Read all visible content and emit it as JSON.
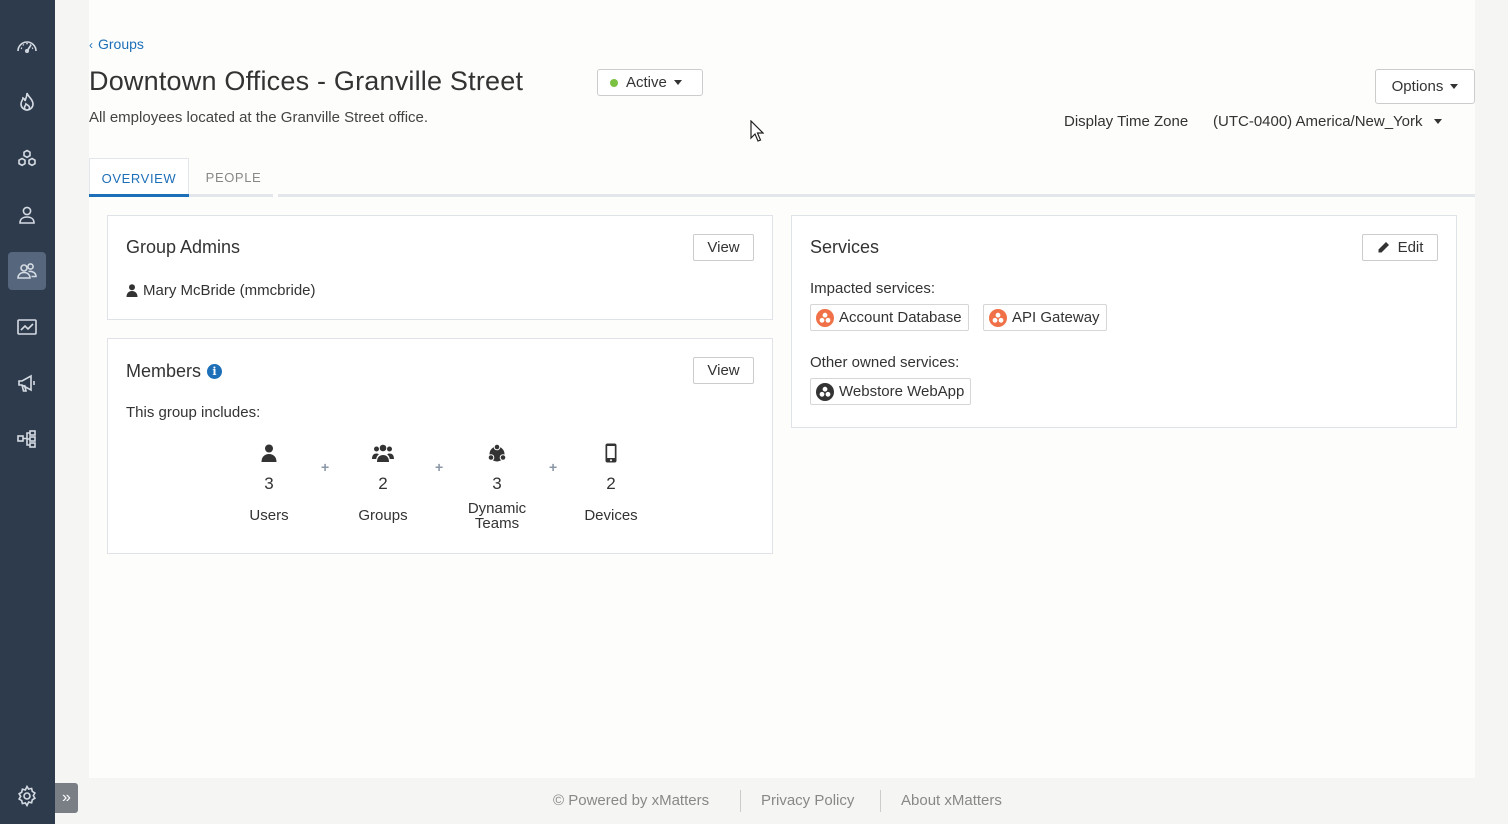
{
  "breadcrumb": {
    "label": "Groups"
  },
  "page": {
    "title": "Downtown Offices - Granville Street",
    "status": "Active",
    "description": "All employees located at the Granville Street office."
  },
  "header": {
    "options_label": "Options",
    "timezone_label": "Display Time Zone",
    "timezone_value": "(UTC-0400) America/New_York"
  },
  "tabs": [
    {
      "label": "OVERVIEW"
    },
    {
      "label": "PEOPLE"
    }
  ],
  "group_admins": {
    "title": "Group Admins",
    "view_label": "View",
    "admin": "Mary McBride (mmcbride)"
  },
  "members": {
    "title": "Members",
    "info_glyph": "i",
    "view_label": "View",
    "includes_label": "This group includes:",
    "plus": "+",
    "stats": [
      {
        "count": "3",
        "label": "Users",
        "icon": "user-icon"
      },
      {
        "count": "2",
        "label": "Groups",
        "icon": "group-icon"
      },
      {
        "count": "3",
        "label": "Dynamic Teams",
        "icon": "dynamic-team-icon"
      },
      {
        "count": "2",
        "label": "Devices",
        "icon": "mobile-device-icon"
      }
    ]
  },
  "services": {
    "title": "Services",
    "edit_label": "Edit",
    "impacted_label": "Impacted services:",
    "impacted": [
      "Account Database",
      "API Gateway"
    ],
    "owned_label": "Other owned services:",
    "owned": [
      "Webstore WebApp"
    ]
  },
  "footer": {
    "powered": "© Powered by xMatters",
    "privacy": "Privacy Policy",
    "about": "About xMatters"
  },
  "colors": {
    "sidebar": "#2e3b4c",
    "accent": "#1d6fb8",
    "status_active": "#7bc142",
    "impacted_service": "#f07148"
  }
}
